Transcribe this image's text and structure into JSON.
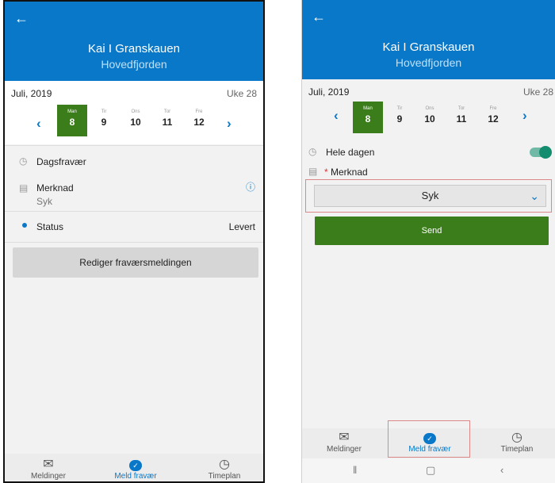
{
  "left": {
    "header": {
      "title": "Kai I Granskauen",
      "subtitle": "Hovedfjorden"
    },
    "calendar": {
      "month": "Juli, 2019",
      "week": "Uke 28",
      "days": [
        {
          "name": "Man",
          "num": "8"
        },
        {
          "name": "Tir",
          "num": "9"
        },
        {
          "name": "Ons",
          "num": "10"
        },
        {
          "name": "Tor",
          "num": "11"
        },
        {
          "name": "Fre",
          "num": "12"
        }
      ]
    },
    "rows": {
      "absence_type": "Dagsfravær",
      "remark_label": "Merknad",
      "remark_value": "Syk",
      "status_label": "Status",
      "status_value": "Levert"
    },
    "edit_button": "Rediger fraværsmeldingen",
    "tabs": [
      "Meldinger",
      "Meld fravær",
      "Timeplan"
    ]
  },
  "right": {
    "header": {
      "title": "Kai I Granskauen",
      "subtitle": "Hovedfjorden"
    },
    "calendar": {
      "month": "Juli, 2019",
      "week": "Uke 28",
      "days": [
        {
          "name": "Man",
          "num": "8"
        },
        {
          "name": "Tir",
          "num": "9"
        },
        {
          "name": "Ons",
          "num": "10"
        },
        {
          "name": "Tor",
          "num": "11"
        },
        {
          "name": "Fre",
          "num": "12"
        }
      ]
    },
    "whole_day_label": "Hele dagen",
    "whole_day_on": true,
    "remark_required_mark": "*",
    "remark_label": "Merknad",
    "remark_selected": "Syk",
    "send_button": "Send",
    "tabs": [
      "Meldinger",
      "Meld fravær",
      "Timeplan"
    ]
  },
  "colors": {
    "brand_blue": "#0a78c8",
    "selected_green": "#3b7d1b",
    "toggle_green": "#148c6e"
  }
}
